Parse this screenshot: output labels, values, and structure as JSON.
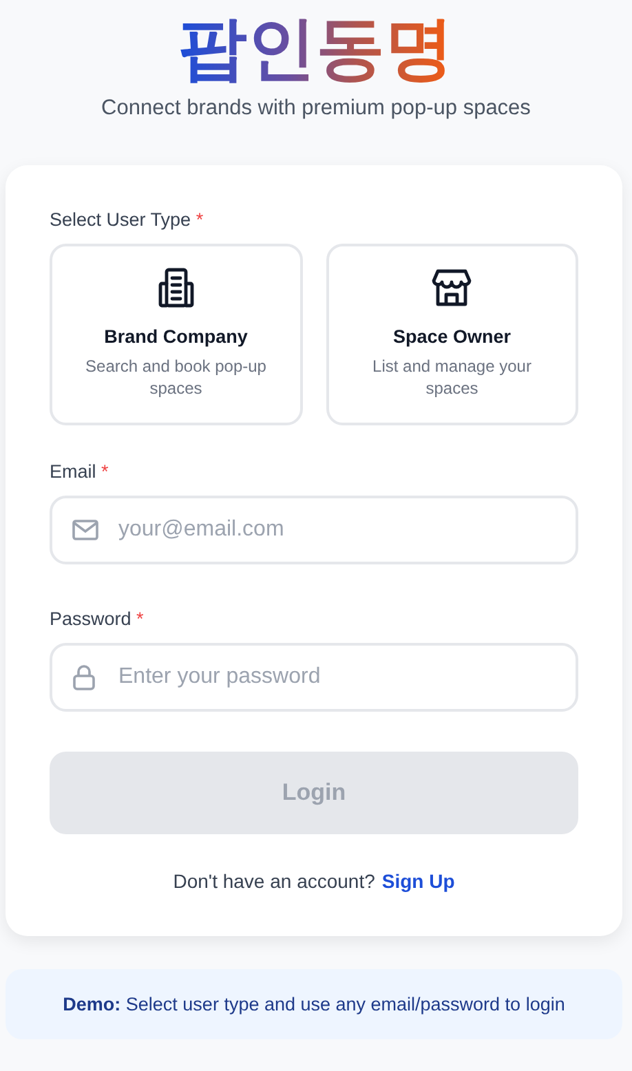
{
  "header": {
    "logo": "팝인동명",
    "tagline": "Connect brands with premium pop-up spaces"
  },
  "form": {
    "user_type_label": "Select User Type",
    "user_type_required_mark": "*",
    "user_types": [
      {
        "kind": "building",
        "title": "Brand Company",
        "description": "Search and book pop-up spaces",
        "selected": false
      },
      {
        "kind": "store",
        "title": "Space Owner",
        "description": "List and manage your spaces",
        "selected": false
      }
    ],
    "fields": [
      {
        "kind": "email",
        "label": "Email",
        "required_mark": "*",
        "placeholder": "your@email.com"
      },
      {
        "kind": "password",
        "label": "Password",
        "required_mark": "*",
        "placeholder": "Enter your password"
      }
    ],
    "submit": {
      "label": "Login",
      "disabled": true
    },
    "signup_prompt": "Don't have an account?",
    "signup_link": "Sign Up"
  },
  "demo_note": "**Demo:** Select user type and use any email/password to login"
}
